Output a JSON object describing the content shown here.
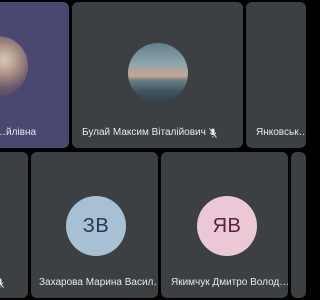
{
  "participants": [
    {
      "name": "…йлівна",
      "muted": false,
      "avatar": "photo-portrait",
      "highlight": true
    },
    {
      "name": "Булай Максим Віталійович",
      "muted": true,
      "avatar": "photo-landscape",
      "highlight": false
    },
    {
      "name": "Янковськ…",
      "muted": false,
      "avatar": "none",
      "highlight": false
    },
    {
      "name": "",
      "muted": true,
      "avatar": "none",
      "highlight": false
    },
    {
      "name": "Захарова Марина Васил…",
      "muted": true,
      "avatar": "initials",
      "initials": "ЗВ",
      "avatar_color": "#a7c0d3",
      "initials_color": "#1e3a55"
    },
    {
      "name": "Якимчук Дмитро Волод…",
      "muted": true,
      "avatar": "initials",
      "initials": "ЯВ",
      "avatar_color": "#ecc8d6",
      "initials_color": "#5a2140"
    }
  ],
  "colors": {
    "tile_bg": "#3c4043",
    "highlight_bg": "#4a4870",
    "page_bg": "#000000"
  }
}
